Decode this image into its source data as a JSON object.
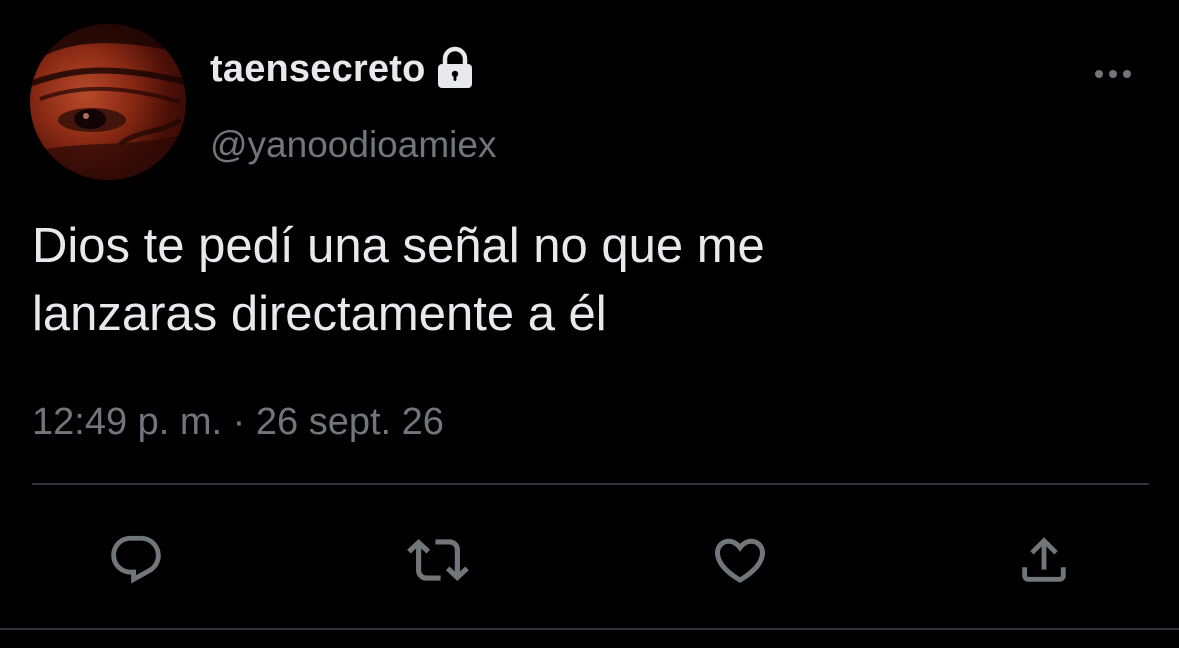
{
  "user": {
    "display_name": "taensecreto",
    "handle": "@yanoodioamiex",
    "protected_icon": "lock-icon",
    "avatar": "profile-photo"
  },
  "tweet": {
    "text": "Dios te pedí una señal no que me\nlanzaras directamente a él",
    "timestamp": "12:49 p. m. · 26 sept. 26"
  },
  "header": {
    "more_icon": "more-horizontal-icon"
  },
  "actions": [
    {
      "icon": "reply-icon"
    },
    {
      "icon": "retweet-icon"
    },
    {
      "icon": "like-icon"
    },
    {
      "icon": "share-icon"
    }
  ],
  "colors": {
    "background": "#000000",
    "primary_text": "#e7e9ea",
    "secondary_text": "#71767b",
    "divider": "#2f3336"
  }
}
